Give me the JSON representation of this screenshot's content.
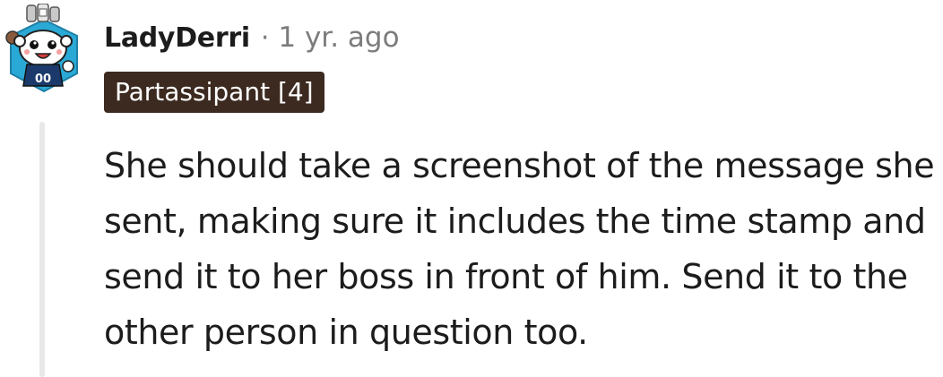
{
  "comment": {
    "username": "LadyDerri",
    "separator": "·",
    "timestamp": "1 yr. ago",
    "flair": "Partassipant [4]",
    "body": "She should take a screenshot of the message she sent, making sure it includes the time stamp and send it to her boss in front of him. Send it to the other person in question too.",
    "avatar": {
      "icon": "snoo-avatar-icon",
      "jersey_number": "00"
    }
  },
  "colors": {
    "flair_background": "#3c2a20",
    "flair_text": "#ffffff",
    "meta_gray": "#7c7c7c",
    "thread_line": "#e8e8e8",
    "avatar_background": "#2aa9d6",
    "jersey": "#1b3a6b"
  }
}
